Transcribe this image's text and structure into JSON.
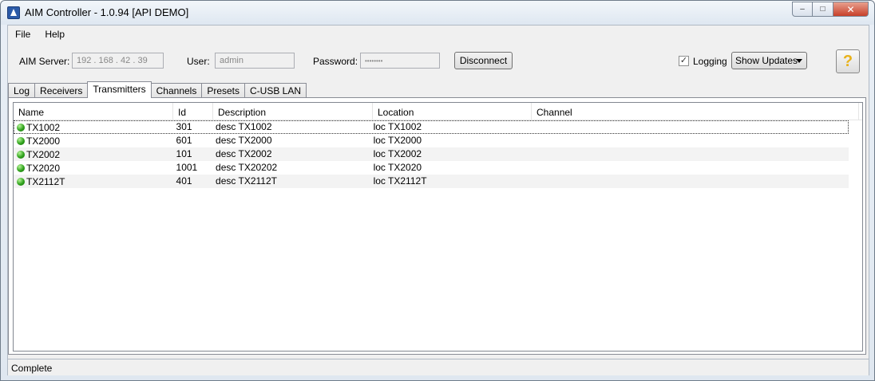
{
  "window": {
    "title": "AIM Controller - 1.0.94   [API DEMO]",
    "buttons": {
      "minimize": "–",
      "maximize": "□",
      "close": "✕"
    }
  },
  "menu": {
    "items": [
      {
        "label": "File"
      },
      {
        "label": "Help"
      }
    ]
  },
  "toolbar": {
    "server_label": "AIM Server:",
    "server_value": "192 . 168 . 42 . 39",
    "user_label": "User:",
    "user_value": "admin",
    "password_label": "Password:",
    "password_value": "••••••••",
    "disconnect_label": "Disconnect",
    "logging_label": "Logging",
    "logging_checked": "✓",
    "show_updates_value": "Show Updates",
    "help_glyph": "?"
  },
  "tabs": [
    {
      "label": "Log"
    },
    {
      "label": "Receivers"
    },
    {
      "label": "Transmitters"
    },
    {
      "label": "Channels"
    },
    {
      "label": "Presets"
    },
    {
      "label": "C-USB LAN"
    }
  ],
  "active_tab": "Transmitters",
  "table": {
    "columns": [
      "Name",
      "Id",
      "Description",
      "Location",
      "Channel"
    ],
    "rows": [
      {
        "name": "TX1002",
        "id": "301",
        "description": "desc TX1002",
        "location": "loc TX1002",
        "channel": ""
      },
      {
        "name": "TX2000",
        "id": "601",
        "description": "desc TX2000",
        "location": "loc TX2000",
        "channel": ""
      },
      {
        "name": "TX2002",
        "id": "101",
        "description": "desc TX2002",
        "location": "loc TX2002",
        "channel": ""
      },
      {
        "name": "TX2020",
        "id": "1001",
        "description": "desc TX20202",
        "location": "loc TX2020",
        "channel": ""
      },
      {
        "name": "TX2112T",
        "id": "401",
        "description": "desc TX2112T",
        "location": "loc TX2112T",
        "channel": ""
      }
    ],
    "status_color": "#2fa21c"
  },
  "status": {
    "text": "Complete"
  }
}
